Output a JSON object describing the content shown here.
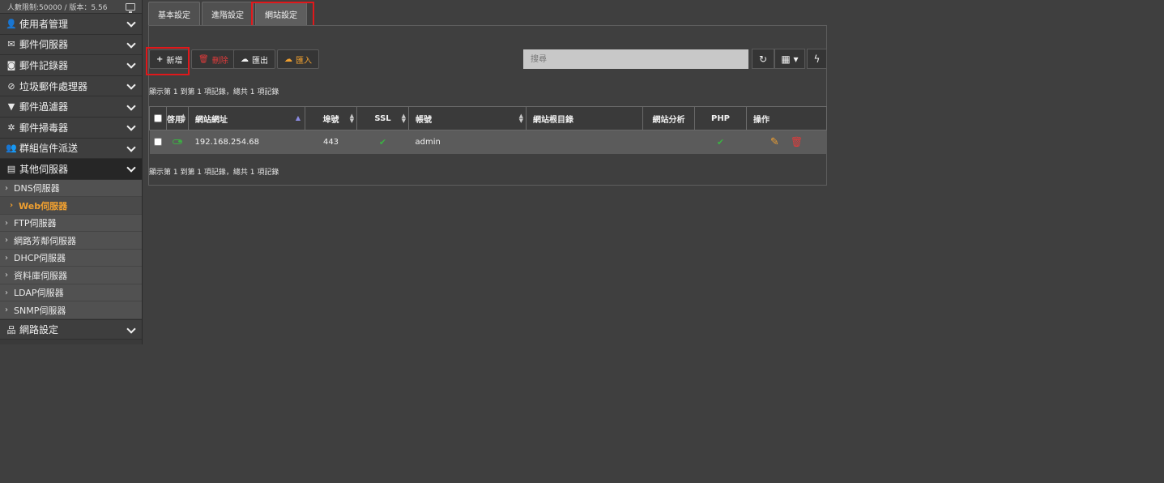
{
  "sidebar": {
    "limit_text": "人數限制:50000 / 版本：5.56",
    "menu": [
      {
        "label": "使用者管理",
        "icon": "user-icon"
      },
      {
        "label": "郵件伺服器",
        "icon": "envelope-icon"
      },
      {
        "label": "郵件記錄器",
        "icon": "camera-icon"
      },
      {
        "label": "垃圾郵件處理器",
        "icon": "ban-icon"
      },
      {
        "label": "郵件過濾器",
        "icon": "filter-icon"
      },
      {
        "label": "郵件掃毒器",
        "icon": "bug-icon"
      },
      {
        "label": "群組信件派送",
        "icon": "users-icon"
      },
      {
        "label": "其他伺服器",
        "icon": "server-icon"
      }
    ],
    "sub_items": [
      "DNS伺服器",
      "Web伺服器",
      "FTP伺服器",
      "網路芳鄰伺服器",
      "DHCP伺服器",
      "資料庫伺服器",
      "LDAP伺服器",
      "SNMP伺服器"
    ],
    "network_label": "網路設定"
  },
  "tabs": [
    "基本設定",
    "進階設定",
    "網站設定"
  ],
  "toolbar": {
    "add_label": "新增",
    "delete_label": "刪除",
    "export_label": "匯出",
    "import_label": "匯入",
    "search_placeholder": "搜尋"
  },
  "info_text": "顯示第 1 到第 1 項記錄，總共 1 項記錄",
  "table": {
    "headers": [
      "啓用",
      "網站網址",
      "埠號",
      "SSL",
      "帳號",
      "網站根目錄",
      "網站分析",
      "PHP",
      "操作"
    ],
    "row": {
      "url": "192.168.254.68",
      "port": "443",
      "account": "admin"
    }
  },
  "colors": {
    "accent": "#f0a030",
    "danger": "#e03b3b",
    "success": "#3cb043",
    "highlight": "#e0181b"
  }
}
